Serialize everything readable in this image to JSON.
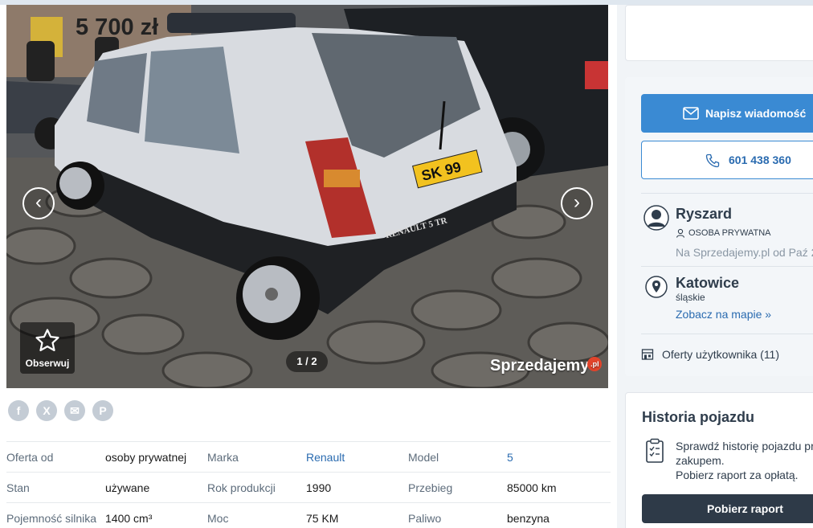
{
  "gallery": {
    "prev_icon": "chevron-left-icon",
    "next_icon": "chevron-right-icon",
    "follow_label": "Obserwuj",
    "counter": "1 / 2",
    "watermark": "Sprzedajemy",
    "watermark_badge": ".pl",
    "plate_text": "SK 99",
    "badge_text": "RENAULT 5 TR"
  },
  "share": {
    "facebook": "f",
    "x": "X",
    "email": "✉",
    "pinterest": "P"
  },
  "params": [
    {
      "l1": "Oferta od",
      "v1": "osoby prywatnej",
      "l2": "Marka",
      "v2": "Renault",
      "l3": "Model",
      "v3": "5"
    },
    {
      "l1": "Stan",
      "v1": "używane",
      "l2": "Rok produkcji",
      "v2": "1990",
      "l3": "Przebieg",
      "v3": "85000 km"
    },
    {
      "l1": "Pojemność silnika",
      "v1": "1400 cm³",
      "l2": "Moc",
      "v2": "75 KM",
      "l3": "Paliwo",
      "v3": "benzyna"
    }
  ],
  "price": "5 700 zł",
  "contact": {
    "message_label": "Napisz wiadomość",
    "phone": "601 438 360"
  },
  "seller": {
    "name": "Ryszard",
    "type": "OSOBA PRYWATNA",
    "since": "Na Sprzedajemy.pl od Paź 2"
  },
  "location": {
    "city": "Katowice",
    "region": "śląskie",
    "map_link": "Zobacz na mapie »"
  },
  "offers_link": "Oferty użytkownika (11)",
  "history": {
    "title": "Historia pojazdu",
    "line1": "Sprawdź historię pojazdu pr",
    "line2": "zakupem.",
    "line3": "Pobierz raport za opłatą.",
    "button": "Pobierz raport"
  },
  "colors": {
    "accent": "#3a8ad3",
    "link": "#2a6bb0",
    "dark_button": "#2e3a48"
  }
}
